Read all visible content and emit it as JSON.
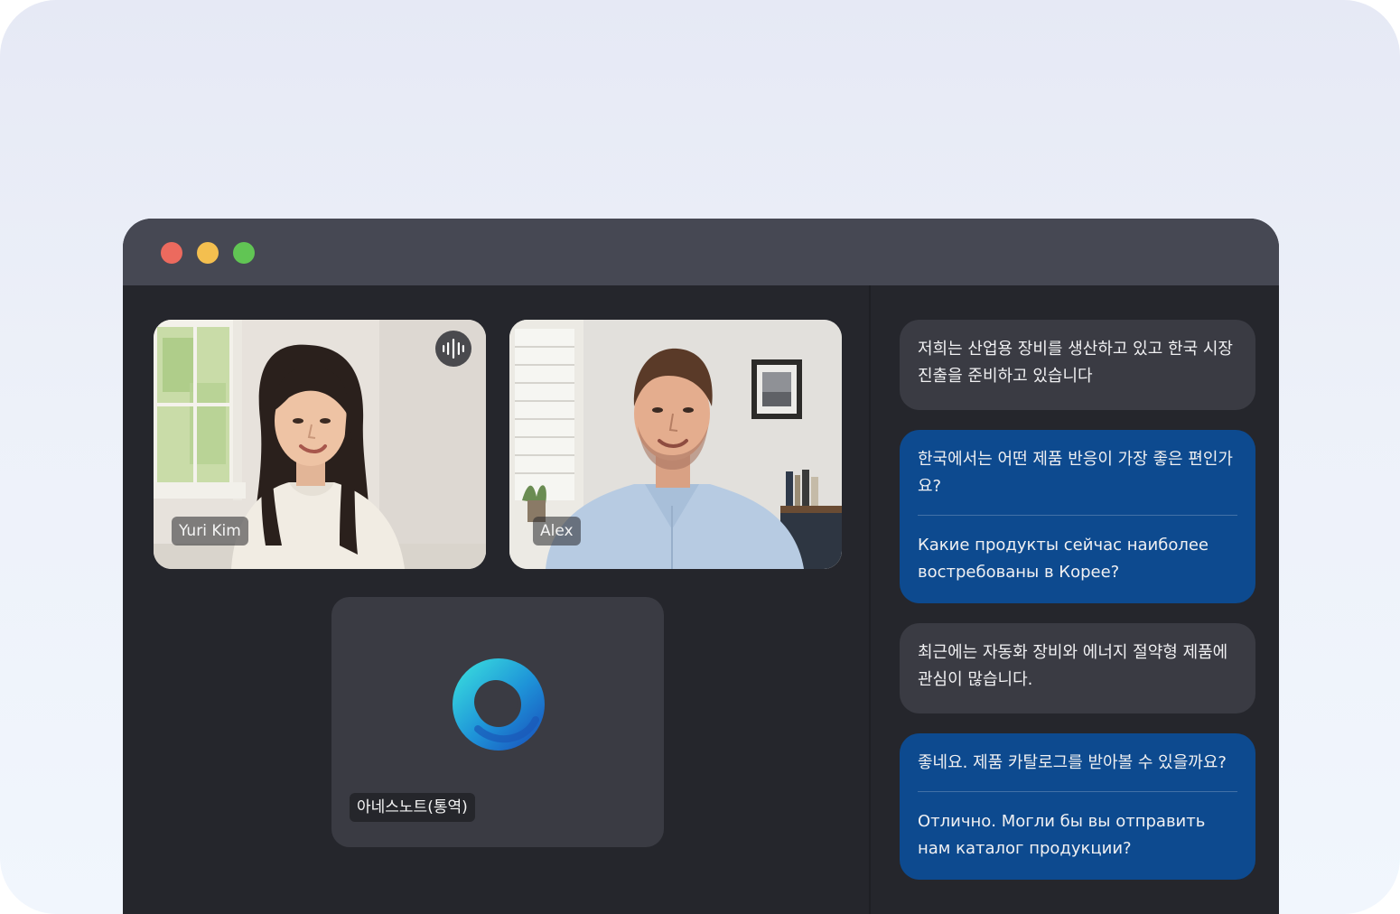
{
  "window": {
    "controls": [
      "close",
      "minimize",
      "zoom"
    ]
  },
  "participants": [
    {
      "name": "Yuri Kim",
      "speaking": true
    },
    {
      "name": "Alex",
      "speaking": false
    },
    {
      "name": "아네스노트(통역)",
      "speaking": false
    }
  ],
  "transcript": [
    {
      "style": "gray",
      "text": "저희는 산업용 장비를 생산하고 있고 한국 시장 진출을 준비하고 있습니다"
    },
    {
      "style": "blue",
      "text": "한국에서는 어떤 제품 반응이 가장 좋은 편인가요?",
      "translation": "Какие продукты сейчас наиболее востребованы в Корее?"
    },
    {
      "style": "gray",
      "text": "최근에는 자동화 장비와 에너지 절약형 제품에 관심이 많습니다."
    },
    {
      "style": "blue",
      "text": "좋네요. 제품 카탈로그를 받아볼 수 있을까요?",
      "translation": "Отлично. Могли бы вы отправить нам каталог продукции?"
    }
  ],
  "colors": {
    "outer_background": "#e9ecf7",
    "title_bar": "#464853",
    "stage": "#25262c",
    "bubble_gray": "#3a3b43",
    "bubble_blue": "#0d4a8f",
    "close": "#ec6a5e",
    "minimize": "#f4bf4f",
    "zoom": "#61c554"
  },
  "icons": {
    "speaking_indicator": "waveform-icon",
    "interpreter_logo": "ring-logo-icon"
  }
}
